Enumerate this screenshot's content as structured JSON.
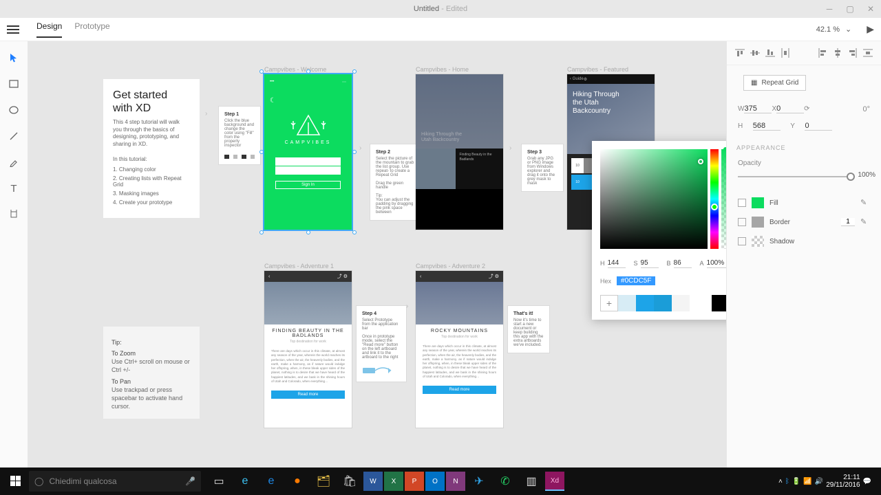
{
  "window": {
    "title": "Untitled",
    "suffix": " - Edited"
  },
  "topbar": {
    "tabs": [
      "Design",
      "Prototype"
    ],
    "active": 0,
    "zoom": "42.1 %"
  },
  "tools": [
    "select",
    "rect",
    "ellipse",
    "line",
    "pen",
    "text",
    "artboard"
  ],
  "tutorial": {
    "title": "Get started with XD",
    "intro": "This 4 step tutorial will walk you through the basics of designing, prototyping, and sharing in XD.",
    "section": "In this tutorial:",
    "steps": [
      "Changing color",
      "Creating lists with Repeat Grid",
      "Masking images",
      "Create your prototype"
    ]
  },
  "tips": {
    "header": "Tip:",
    "zoom_h": "To Zoom",
    "zoom": "Use Ctrl+ scroll on mouse or Ctrl +/-",
    "pan_h": "To Pan",
    "pan": "Use trackpad or press spacebar to activate hand cursor."
  },
  "artboards": {
    "welcome": {
      "label": "Campvibes - Welcome",
      "brand": "CAMPVIBES",
      "signin": "Sign In"
    },
    "home": {
      "label": "Campvibes - Home",
      "hero": "Hiking Through the Utah Backcountry",
      "card": "Finding Beauty in the Badlands"
    },
    "featured": {
      "label": "Campvibes - Featured",
      "title": "Hiking Through the Utah Backcountry",
      "date": "10"
    },
    "adv1": {
      "label": "Campvibes - Adventure 1",
      "title": "FINDING BEAUTY IN THE BADLANDS",
      "sub": "Top destination for work",
      "btn": "Read more"
    },
    "adv2": {
      "label": "Campvibes - Adventure 2",
      "title": "ROCKY MOUNTAINS",
      "sub": "Top destination for work",
      "btn": "Read more"
    }
  },
  "bodytext": "There are days which occur in this climate, at almost any season of the year, wherein the world reaches its perfection, when the air, the heavenly bodies, and the earth, make a harmony, as if nature would indulge her offspring, when, in these bleak upper sides of the planet, nothing is to desire that we have heard of the happiest latitudes, and we bask in the shining hours of Utah and Colorado, when everything…",
  "stepcards": {
    "s1": {
      "h": "Step 1",
      "t": "Click the blue background and change the color using \"Fill\" from the property inspector"
    },
    "s2": {
      "h": "Step 2",
      "t": "Select the picture of the mountain to grab the list group. Use repeat- to create a Repeat Grid\n\nDrag the green handle\n\nTip:\nYou can adjust the padding by dragging the pink space between"
    },
    "s3": {
      "h": "Step 3",
      "t": "Grab any JPG or PNG image from Windows explorer and drag it onto the grey mask to mask"
    },
    "s4": {
      "h": "Step 4",
      "t": "Select Prototype from the application bar\n\nOnce in prototype mode, select the \"Read more\" button on the left artboard and link it to the artboard to the right"
    },
    "s5": {
      "h": "That's it!",
      "t": "Now it's time to start a new document or keep building this app with the extra artboards we've included."
    }
  },
  "picker": {
    "h": "144",
    "s": "95",
    "b": "86",
    "a": "100%",
    "hex": "#0CDC5F",
    "swatches": [
      "#d7ecf5",
      "#1da4e8",
      "#1b9dd8",
      "#f4f4f4",
      "#000000"
    ]
  },
  "panel": {
    "repeat": "Repeat Grid",
    "w": "375",
    "x": "0",
    "rot": "0°",
    "h": "568",
    "y": "0",
    "appearance": "APPEARANCE",
    "opacity": "Opacity",
    "opval": "100%",
    "fill": {
      "label": "Fill",
      "color": "#0CDC5F"
    },
    "border": {
      "label": "Border",
      "color": "#a6a6a6",
      "width": "1"
    },
    "shadow": {
      "label": "Shadow"
    }
  },
  "taskbar": {
    "search": "Chiedimi qualcosa",
    "time": "21:11",
    "date": "29/11/2016"
  }
}
